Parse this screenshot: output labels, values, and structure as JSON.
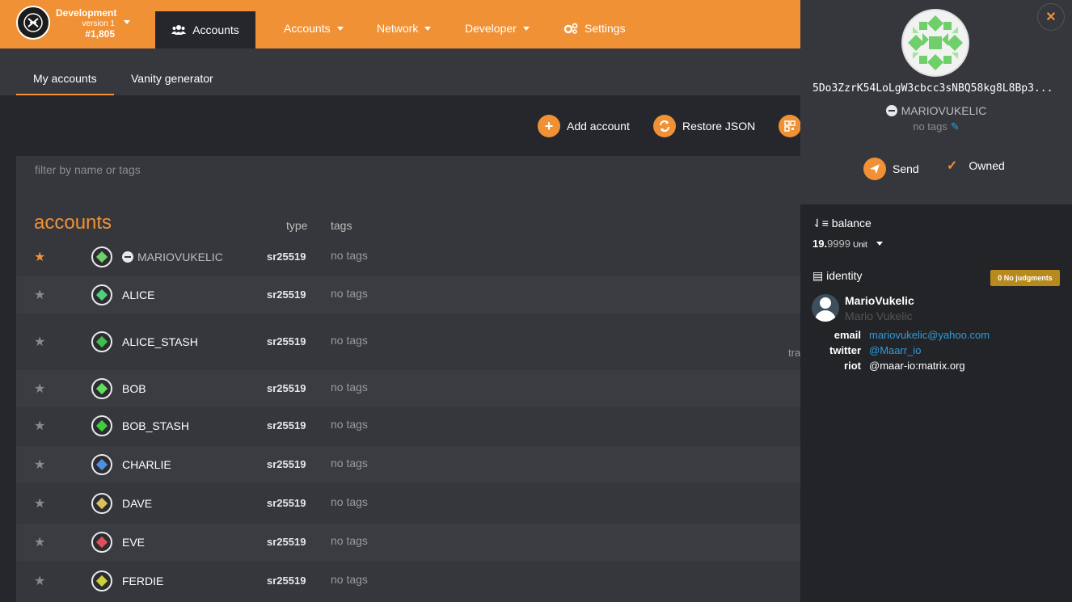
{
  "chain": {
    "name": "Development",
    "version": "version 1",
    "block": "#1,805"
  },
  "topnav": {
    "active_tab": "Accounts",
    "items": [
      {
        "label": "Accounts",
        "dropdown": true
      },
      {
        "label": "Network",
        "dropdown": true
      },
      {
        "label": "Developer",
        "dropdown": true
      },
      {
        "label": "Settings",
        "dropdown": false
      }
    ]
  },
  "subnav": {
    "tabs": [
      "My accounts",
      "Vanity generator"
    ],
    "active": "My accounts"
  },
  "actions": {
    "add": "Add account",
    "restore": "Restore JSON"
  },
  "filter": {
    "placeholder": "filter by name or tags"
  },
  "table": {
    "title": "accounts",
    "col_type": "type",
    "col_tags": "tags",
    "rows": [
      {
        "name": "MARIOVUKELIC",
        "type": "sr25519",
        "tags": "no tags",
        "favorite": true,
        "color": "#6fcf6a"
      },
      {
        "name": "ALICE",
        "type": "sr25519",
        "tags": "no tags",
        "favorite": false,
        "color": "#4fcf7a"
      },
      {
        "name": "ALICE_STASH",
        "type": "sr25519",
        "tags": "no tags",
        "favorite": false,
        "color": "#3fbf4a"
      },
      {
        "name": "BOB",
        "type": "sr25519",
        "tags": "no tags",
        "favorite": false,
        "color": "#5fdf5a"
      },
      {
        "name": "BOB_STASH",
        "type": "sr25519",
        "tags": "no tags",
        "favorite": false,
        "color": "#3fcf3a"
      },
      {
        "name": "CHARLIE",
        "type": "sr25519",
        "tags": "no tags",
        "favorite": false,
        "color": "#4f8fdf"
      },
      {
        "name": "DAVE",
        "type": "sr25519",
        "tags": "no tags",
        "favorite": false,
        "color": "#dfbf5a"
      },
      {
        "name": "EVE",
        "type": "sr25519",
        "tags": "no tags",
        "favorite": false,
        "color": "#df4f5a"
      },
      {
        "name": "FERDIE",
        "type": "sr25519",
        "tags": "no tags",
        "favorite": false,
        "color": "#cfcf3a"
      }
    ],
    "clipped_text": "tra"
  },
  "sidebar": {
    "address": "5Do3ZzrK54LoLgW3cbcc3sNBQ58kg8L8Bp3...",
    "name": "MARIOVUKELIC",
    "tags": "no tags",
    "send": "Send",
    "owned": "Owned",
    "balance_label": "balance",
    "balance_int": "19.",
    "balance_dec": "9999",
    "balance_unit": "Unit",
    "identity_label": "identity",
    "judgment_badge": "0 No judgments",
    "display_name": "MarioVukelic",
    "legal_name": "Mario Vukelic",
    "fields": [
      {
        "key": "email",
        "value": "mariovukelic@yahoo.com"
      },
      {
        "key": "twitter",
        "value": "@Maarr_io"
      },
      {
        "key": "riot",
        "value": "@maar-io:matrix.org"
      }
    ]
  },
  "colors": {
    "accent": "#f19135",
    "bg": "#26272c",
    "panel": "#36373c",
    "link": "#2f9bd8"
  }
}
